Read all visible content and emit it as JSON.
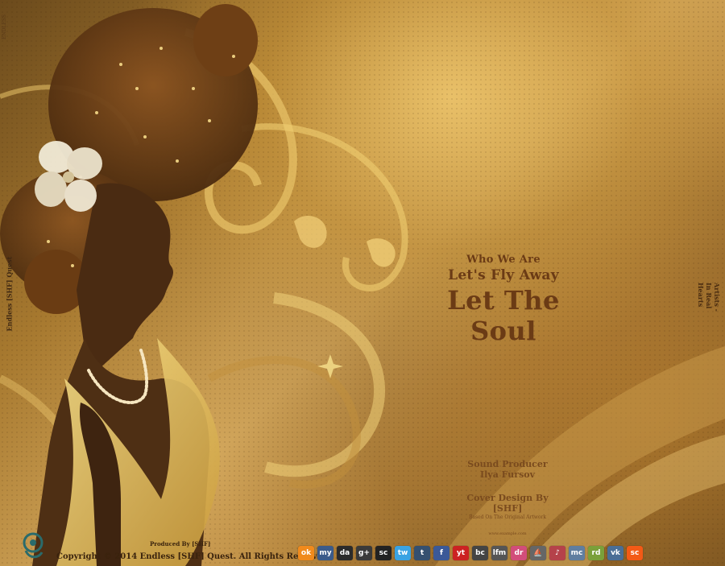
{
  "cover": {
    "title_small": "Who We Are",
    "title_medium": "Let's Fly Away",
    "title_large": "Let The Soul",
    "sound_producer_label": "Sound Producer",
    "sound_producer_name": "Ilya Fursov",
    "cover_design": "Cover Design By [SHF]",
    "cover_design_note": "Based On The Original Artwork",
    "small_url": "www.example.com",
    "produced_by": "Produced By [SHF]",
    "copyright": "Copyright © 2014 Endless [SHF] Quest. All Rights Reserved",
    "spine_left": "Endless [SHF] Quest",
    "spine_left_top": "ENDLESS",
    "spine_right": "Artists - In Real Hearts"
  },
  "colors": {
    "text_brown": "#6b3b15",
    "gold": "#d2a65b"
  },
  "socials": [
    {
      "icon": "odnoklassniki-icon",
      "label": "ok",
      "color": "#f08a1c"
    },
    {
      "icon": "myspace-icon",
      "label": "my",
      "color": "#3b5b8a"
    },
    {
      "icon": "deviantart-icon",
      "label": "da",
      "color": "#2b2b2b"
    },
    {
      "icon": "google-plus-icon",
      "label": "g+",
      "color": "#3a3a3a"
    },
    {
      "icon": "soundcloud-cloud-icon",
      "label": "sc",
      "color": "#222222"
    },
    {
      "icon": "twitter-icon",
      "label": "tw",
      "color": "#3aa3e3"
    },
    {
      "icon": "tumblr-icon",
      "label": "t",
      "color": "#355070"
    },
    {
      "icon": "facebook-icon",
      "label": "f",
      "color": "#3b5998"
    },
    {
      "icon": "youtube-icon",
      "label": "yt",
      "color": "#cc2222"
    },
    {
      "icon": "bandcamp-icon",
      "label": "bc",
      "color": "#444444"
    },
    {
      "icon": "lastfm-icon",
      "label": "lfm",
      "color": "#555555"
    },
    {
      "icon": "dribbble-icon",
      "label": "dr",
      "color": "#d24d7a"
    },
    {
      "icon": "boat-icon",
      "label": "⛵",
      "color": "#666666"
    },
    {
      "icon": "music-icon",
      "label": "♪",
      "color": "#b5424a"
    },
    {
      "icon": "mixcloud-icon",
      "label": "mc",
      "color": "#5f7ea0"
    },
    {
      "icon": "radio-icon",
      "label": "rd",
      "color": "#7aa03a"
    },
    {
      "icon": "vk-icon",
      "label": "vk",
      "color": "#4a6e96"
    },
    {
      "icon": "soundcloud-icon",
      "label": "sc",
      "color": "#f35a16"
    }
  ]
}
